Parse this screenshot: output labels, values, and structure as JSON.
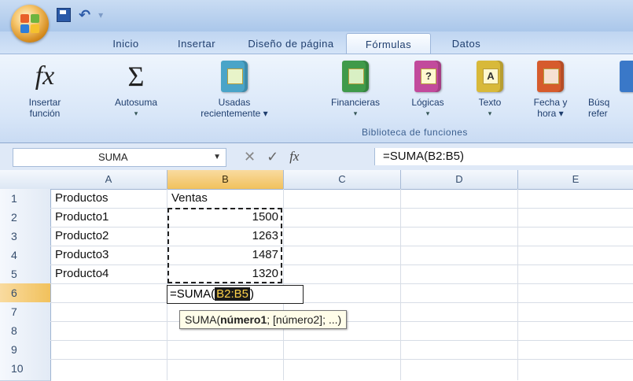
{
  "titlebar": {
    "office_button_icon": "office-logo-icon",
    "quick_access": {
      "save_icon": "save-icon",
      "undo_icon": "undo-icon",
      "undo_glyph": "↶"
    }
  },
  "tabs": [
    {
      "label": "Inicio",
      "active": false
    },
    {
      "label": "Insertar",
      "active": false
    },
    {
      "label": "Diseño de página",
      "active": false
    },
    {
      "label": "Fórmulas",
      "active": true
    },
    {
      "label": "Datos",
      "active": false
    }
  ],
  "ribbon": {
    "insert_function": {
      "line1": "Insertar",
      "line2": "función",
      "icon": "fx-icon",
      "glyph": "fx"
    },
    "autosum": {
      "line1": "Autosuma",
      "icon": "sigma-icon",
      "glyph": "Σ"
    },
    "recent": {
      "line1": "Usadas",
      "line2": "recientemente",
      "icon": "recent-book-icon",
      "color": "#4aa4c8"
    },
    "financial": {
      "line1": "Financieras",
      "icon": "financial-book-icon",
      "color": "#3f9a4a"
    },
    "logical": {
      "line1": "Lógicas",
      "icon": "logical-book-icon",
      "color": "#c24a9c",
      "badge": "?"
    },
    "text": {
      "line1": "Texto",
      "icon": "text-book-icon",
      "color": "#d8b93a",
      "badge": "A"
    },
    "datetime": {
      "line1": "Fecha y",
      "line2": "hora",
      "icon": "datetime-book-icon",
      "color": "#d65b2d"
    },
    "lookup": {
      "line1": "Búsq",
      "line2": "refer",
      "icon": "lookup-book-icon",
      "color": "#3a78c8"
    },
    "group_label": "Biblioteca de funciones"
  },
  "formula_bar": {
    "name_box": "SUMA",
    "cancel_glyph": "✕",
    "enter_glyph": "✓",
    "fx_glyph": "fx",
    "content": "=SUMA(B2:B5)"
  },
  "sheet": {
    "columns": [
      "A",
      "B",
      "C",
      "D",
      "E"
    ],
    "rows": [
      "1",
      "2",
      "3",
      "4",
      "5",
      "6",
      "7",
      "8",
      "9",
      "10"
    ],
    "cells": {
      "A1": "Productos",
      "B1": "Ventas",
      "A2": "Producto1",
      "B2": "1500",
      "A3": "Producto2",
      "B3": "1263",
      "A4": "Producto3",
      "B4": "1487",
      "A5": "Producto4",
      "B5": "1320"
    },
    "editing": {
      "prefix": "=SUMA(",
      "range": "B2:B5",
      "suffix": ")"
    },
    "tooltip": {
      "fn": "SUMA(",
      "arg1": "número1",
      "rest": "; [número2]; ...)"
    }
  }
}
